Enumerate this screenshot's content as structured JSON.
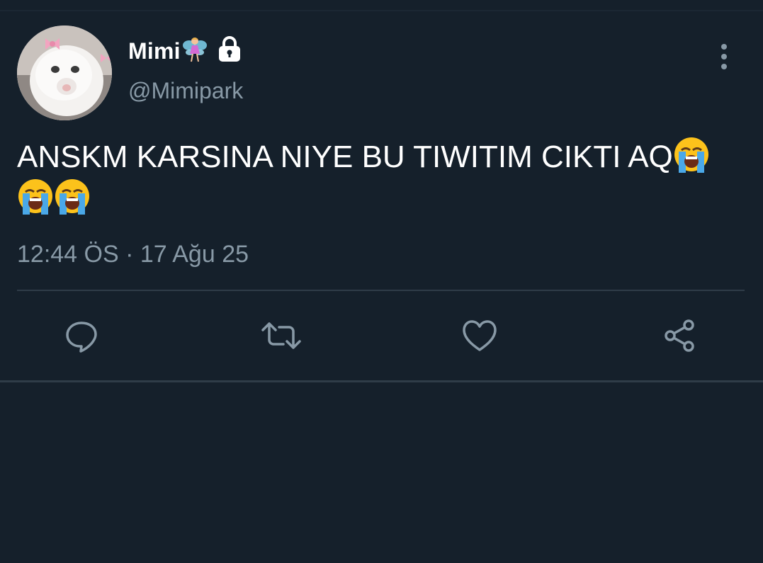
{
  "tweet": {
    "display_name": "Mimi",
    "name_emoji": "fairy-emoji",
    "protected_icon": "lock-icon",
    "handle": "@Mimipark",
    "text_main": "ANSKM KARSINA NIYE BU TIWITIM CIKTI AQ",
    "trailing_emoji": "loudly-crying-face-emoji",
    "timestamp": "12:44 ÖS · 17 Ağu 25"
  },
  "actions": [
    {
      "name": "reply",
      "icon": "reply-icon"
    },
    {
      "name": "retweet",
      "icon": "retweet-icon"
    },
    {
      "name": "like",
      "icon": "heart-icon"
    },
    {
      "name": "share",
      "icon": "share-icon"
    }
  ],
  "colors": {
    "background": "#15202b",
    "text_primary": "#ffffff",
    "text_secondary": "#8899a6",
    "divider": "#2f3c48"
  }
}
